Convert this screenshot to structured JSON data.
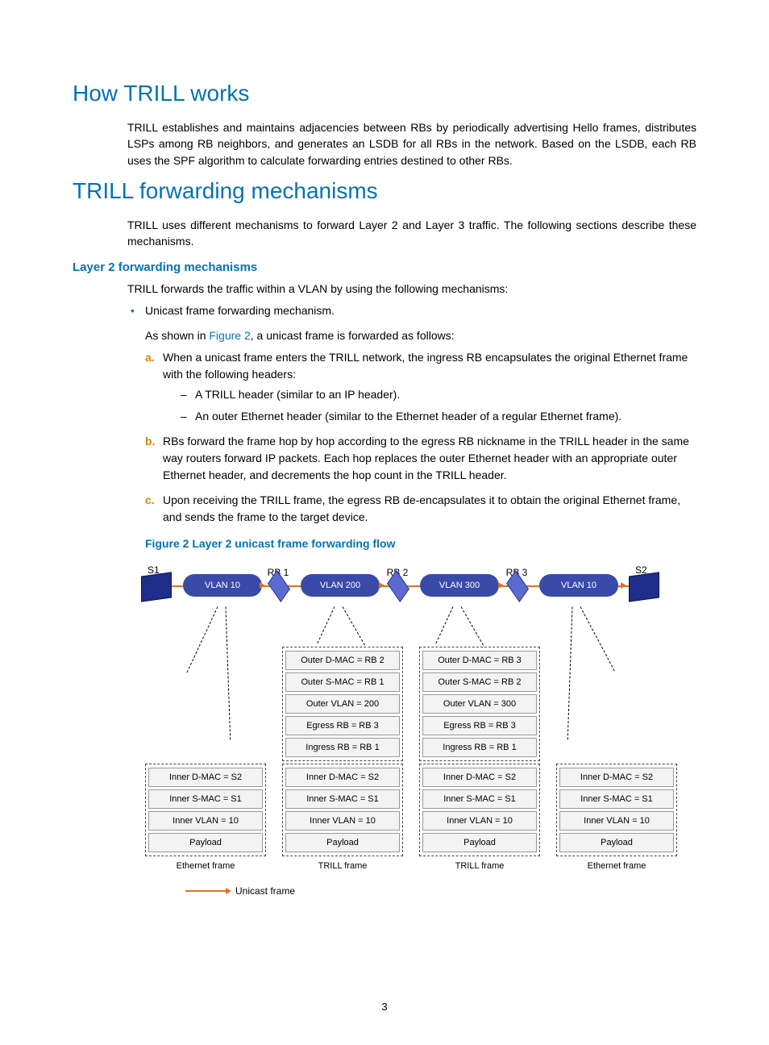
{
  "h1_1": "How TRILL works",
  "p1": "TRILL establishes and maintains adjacencies between RBs by periodically advertising Hello frames, distributes LSPs among RB neighbors, and generates an LSDB for all RBs in the network. Based on the LSDB, each RB uses the SPF algorithm to calculate forwarding entries destined to other RBs.",
  "h1_2": "TRILL forwarding mechanisms",
  "p2": "TRILL uses different mechanisms to forward Layer 2 and Layer 3 traffic. The following sections describe these mechanisms.",
  "h3_1": "Layer 2 forwarding mechanisms",
  "p3": "TRILL forwards the traffic within a VLAN by using the following mechanisms:",
  "bullet1": "Unicast frame forwarding mechanism.",
  "sub_p1_a": "As shown in ",
  "fig_link": "Figure 2",
  "sub_p1_b": ", a unicast frame is forwarded as follows:",
  "li_a_marker": "a.",
  "li_a": "When a unicast frame enters the TRILL network, the ingress RB encapsulates the original Ethernet frame with the following headers:",
  "dash1": "A TRILL header (similar to an IP header).",
  "dash2": "An outer Ethernet header (similar to the Ethernet header of a regular Ethernet frame).",
  "li_b_marker": "b.",
  "li_b": "RBs forward the frame hop by hop according to the egress RB nickname in the TRILL header in the same way routers forward IP packets. Each hop replaces the outer Ethernet header with an appropriate outer Ethernet header, and decrements the hop count in the TRILL header.",
  "li_c_marker": "c.",
  "li_c": "Upon receiving the TRILL frame, the egress RB de-encapsulates it to obtain the original Ethernet frame, and sends the frame to the target device.",
  "fig_caption": "Figure 2 Layer 2 unicast frame forwarding flow",
  "diagram": {
    "s1": "S1",
    "s2": "S2",
    "rb1": "RB 1",
    "rb2": "RB 2",
    "rb3": "RB 3",
    "vlan10": "VLAN 10",
    "vlan200": "VLAN 200",
    "vlan300": "VLAN 300",
    "cols": [
      {
        "outer": [],
        "inner": [
          "Inner D-MAC = S2",
          "Inner S-MAC = S1",
          "Inner VLAN = 10",
          "Payload"
        ],
        "label": "Ethernet frame"
      },
      {
        "outer": [
          "Outer D-MAC = RB 2",
          "Outer S-MAC = RB 1",
          "Outer VLAN = 200",
          "Egress RB = RB 3",
          "Ingress RB = RB 1"
        ],
        "inner": [
          "Inner D-MAC = S2",
          "Inner S-MAC = S1",
          "Inner VLAN = 10",
          "Payload"
        ],
        "label": "TRILL frame"
      },
      {
        "outer": [
          "Outer D-MAC = RB 3",
          "Outer S-MAC = RB 2",
          "Outer VLAN = 300",
          "Egress RB = RB 3",
          "Ingress RB = RB 1"
        ],
        "inner": [
          "Inner D-MAC = S2",
          "Inner S-MAC = S1",
          "Inner VLAN = 10",
          "Payload"
        ],
        "label": "TRILL frame"
      },
      {
        "outer": [],
        "inner": [
          "Inner D-MAC = S2",
          "Inner S-MAC = S1",
          "Inner VLAN = 10",
          "Payload"
        ],
        "label": "Ethernet frame"
      }
    ]
  },
  "legend": "Unicast frame",
  "page_number": "3"
}
